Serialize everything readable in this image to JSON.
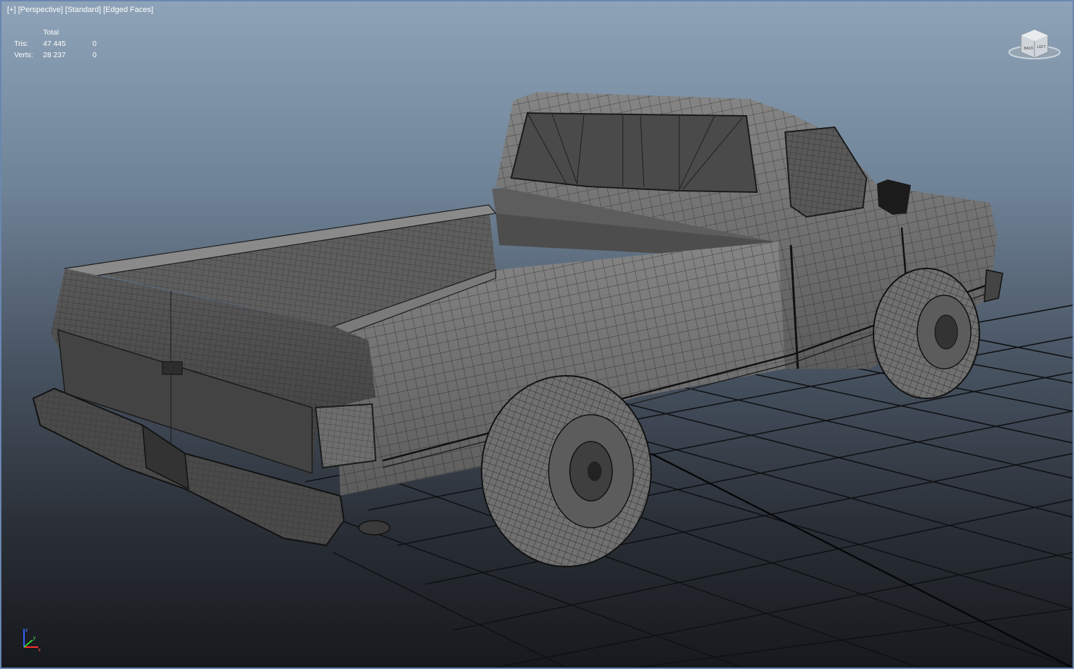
{
  "viewport": {
    "labels": {
      "plus": "[+]",
      "view": "[Perspective]",
      "shading": "[Standard]",
      "display": "[Edged Faces]"
    },
    "stats": {
      "header": "Total",
      "tris_label": "Tris:",
      "tris_total": "47 445",
      "tris_selected": "0",
      "verts_label": "Verts:",
      "verts_total": "28 237",
      "verts_selected": "0"
    },
    "viewcube": {
      "icon": "viewcube-icon",
      "face_labels": [
        "BACK",
        "LEFT"
      ]
    },
    "axis_tripod": {
      "labels": [
        "z",
        "x",
        "y"
      ],
      "colors": {
        "x": "#ff3030",
        "y": "#30d030",
        "z": "#3060ff"
      }
    },
    "model": {
      "description_icon": "pickup-truck-wireframe"
    },
    "colors": {
      "border": "#6a86b0",
      "grid": "#0f1114",
      "mesh_fill": "#707070",
      "wire": "#1a1a1a"
    }
  }
}
